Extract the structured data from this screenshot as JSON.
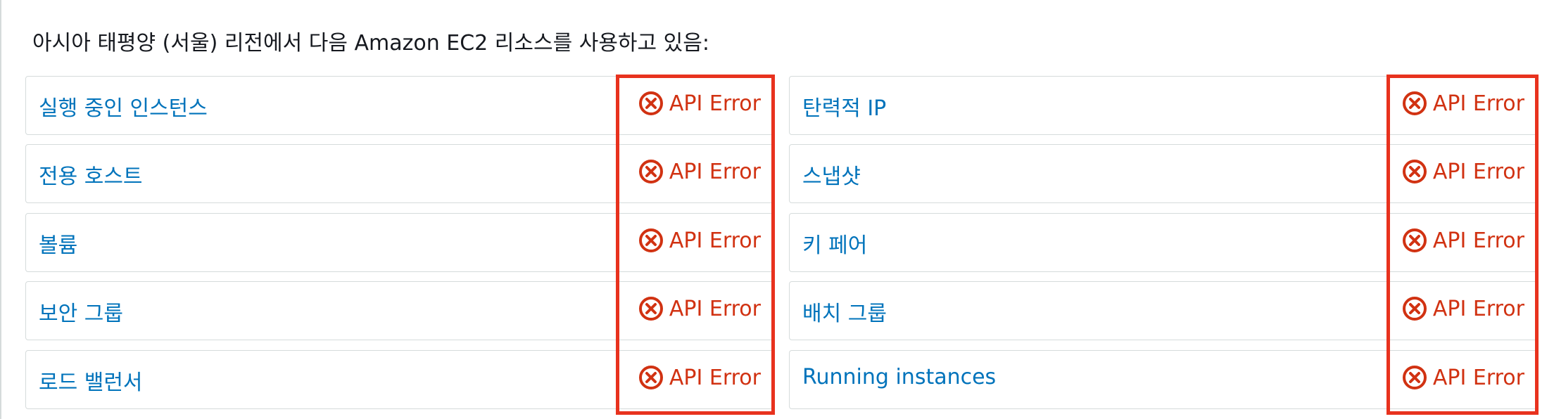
{
  "heading": "아시아 태평양 (서울) 리전에서 다음 Amazon EC2 리소스를 사용하고 있음:",
  "error_label": "API Error",
  "error_icon": "x-circle-icon",
  "colors": {
    "link": "#0073bb",
    "error": "#d13212",
    "highlight": "#e8321e",
    "border": "#d5dbdb"
  },
  "left_column": [
    {
      "label": "실행 중인 인스턴스",
      "status": "API Error"
    },
    {
      "label": "전용 호스트",
      "status": "API Error"
    },
    {
      "label": "볼륨",
      "status": "API Error"
    },
    {
      "label": "보안 그룹",
      "status": "API Error"
    },
    {
      "label": "로드 밸런서",
      "status": "API Error"
    }
  ],
  "right_column": [
    {
      "label": "탄력적 IP",
      "status": "API Error"
    },
    {
      "label": "스냅샷",
      "status": "API Error"
    },
    {
      "label": "키 페어",
      "status": "API Error"
    },
    {
      "label": "배치 그룹",
      "status": "API Error"
    },
    {
      "label": "Running instances",
      "status": "API Error"
    }
  ]
}
